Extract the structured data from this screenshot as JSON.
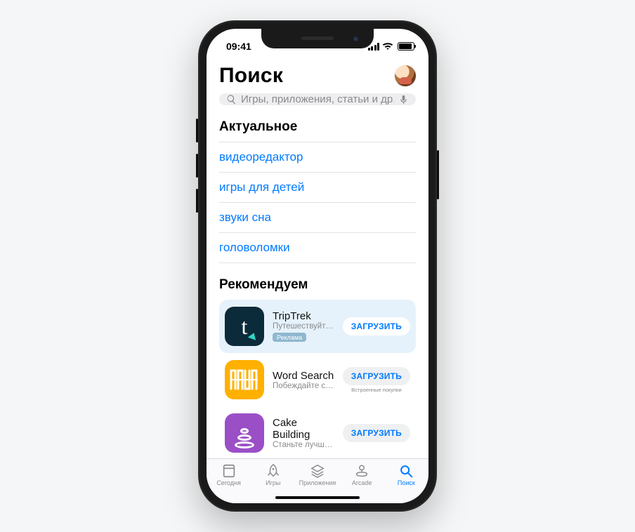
{
  "status": {
    "time": "09:41"
  },
  "header": {
    "title": "Поиск"
  },
  "search": {
    "placeholder": "Игры, приложения, статьи и др."
  },
  "trending": {
    "title": "Актуальное",
    "items": [
      "видеоредактор",
      "игры для детей",
      "звуки сна",
      "головоломки"
    ]
  },
  "suggested": {
    "title": "Рекомендуем",
    "apps": [
      {
        "name": "TripTrek",
        "subtitle": "Путешествуйте, отслежи...",
        "ad_label": "Реклама",
        "button": "ЗАГРУЗИТЬ",
        "highlight": true,
        "icon": "triptrek"
      },
      {
        "name": "Word Search",
        "subtitle": "Побеждайте с помощью...",
        "button": "ЗАГРУЗИТЬ",
        "iap": "Встроенные покупки",
        "icon": "word"
      },
      {
        "name": "Cake Building",
        "subtitle": "Станьте лучшим пекарем!",
        "button": "ЗАГРУЗИТЬ",
        "icon": "cake"
      }
    ]
  },
  "tabs": [
    {
      "label": "Сегодня",
      "icon": "today"
    },
    {
      "label": "Игры",
      "icon": "games"
    },
    {
      "label": "Приложения",
      "icon": "apps"
    },
    {
      "label": "Arcade",
      "icon": "arcade"
    },
    {
      "label": "Поиск",
      "icon": "search",
      "active": true
    }
  ]
}
